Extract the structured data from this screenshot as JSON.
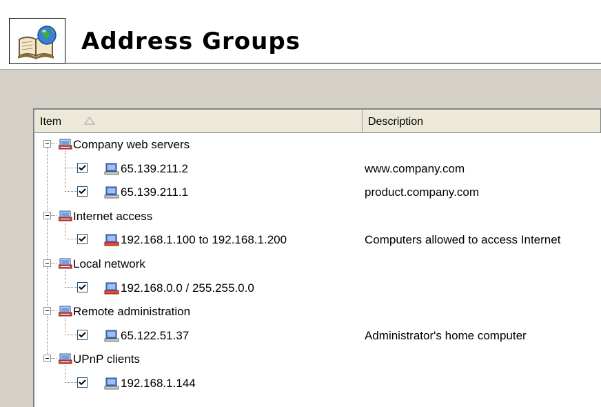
{
  "page_title": "Address Groups",
  "columns": {
    "item": "Item",
    "description": "Description"
  },
  "groups": [
    {
      "name": "Company web servers",
      "items": [
        {
          "address": "65.139.211.2",
          "description": "www.company.com",
          "checked": true,
          "icon": "computer-icon"
        },
        {
          "address": "65.139.211.1",
          "description": "product.company.com",
          "checked": true,
          "icon": "computer-icon"
        }
      ]
    },
    {
      "name": "Internet access",
      "items": [
        {
          "address": "192.168.1.100 to 192.168.1.200",
          "description": "Computers allowed to access Internet",
          "checked": true,
          "icon": "network-range-icon"
        }
      ]
    },
    {
      "name": "Local network",
      "items": [
        {
          "address": "192.168.0.0 / 255.255.0.0",
          "description": "",
          "checked": true,
          "icon": "network-range-icon"
        }
      ]
    },
    {
      "name": "Remote administration",
      "items": [
        {
          "address": "65.122.51.37",
          "description": "Administrator's home computer",
          "checked": true,
          "icon": "computer-icon"
        }
      ]
    },
    {
      "name": "UPnP clients",
      "items": [
        {
          "address": "192.168.1.144",
          "description": "",
          "checked": true,
          "icon": "computer-icon"
        }
      ]
    }
  ],
  "colors": {
    "background": "#d4d0c8",
    "header_bg": "#ffffff",
    "list_bg": "#ffffff",
    "column_header_bg": "#ece9d8"
  }
}
